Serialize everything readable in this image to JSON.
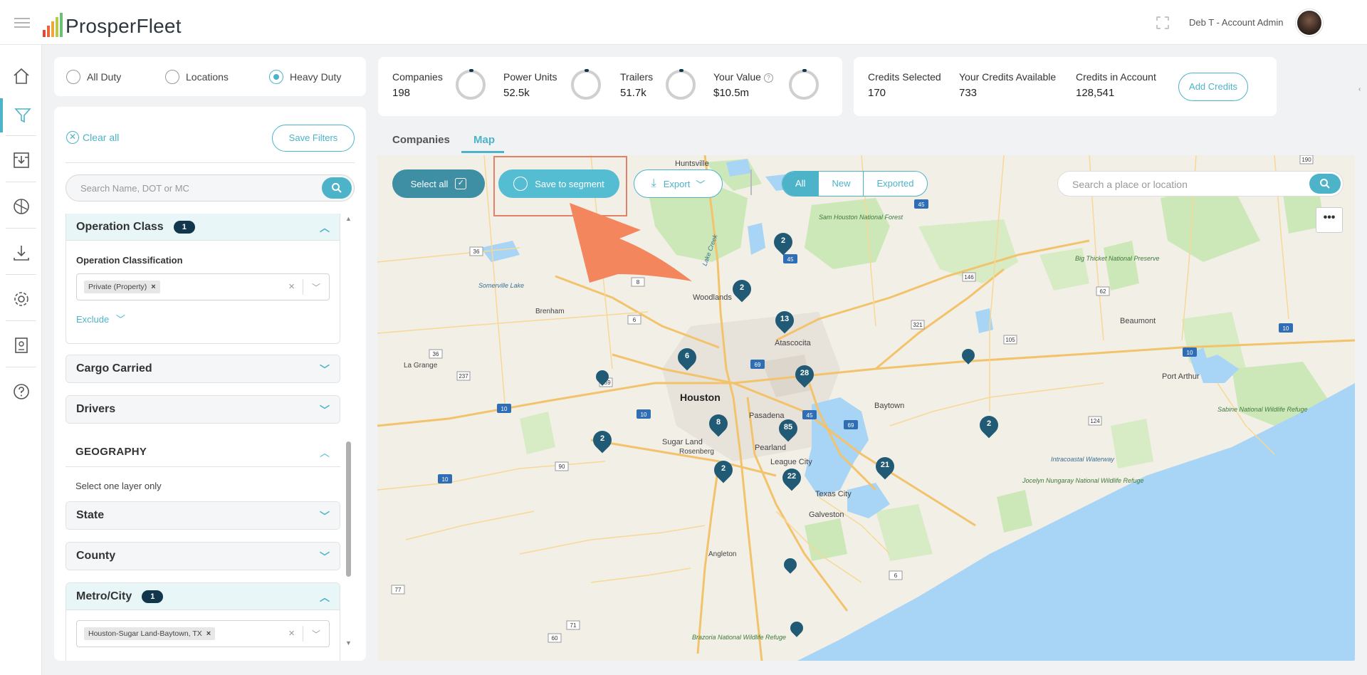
{
  "app": {
    "name": "ProsperFleet",
    "user": "Deb T - Account Admin"
  },
  "duty": {
    "options": [
      "All Duty",
      "Locations",
      "Heavy Duty"
    ],
    "selected": "Heavy Duty"
  },
  "filters": {
    "clear_all": "Clear all",
    "save_filters": "Save Filters",
    "search_placeholder": "Search Name, DOT or MC",
    "operation_class": {
      "title": "Operation Class",
      "count": "1",
      "sub_label": "Operation Classification",
      "chip": "Private (Property)",
      "exclude": "Exclude"
    },
    "cargo_carried": "Cargo Carried",
    "drivers": "Drivers",
    "geography": {
      "title": "GEOGRAPHY",
      "note": "Select one layer only",
      "state": "State",
      "county": "County",
      "metro": {
        "title": "Metro/City",
        "count": "1",
        "chip": "Houston-Sugar Land-Baytown, TX"
      }
    }
  },
  "stats": {
    "companies": {
      "label": "Companies",
      "value": "198"
    },
    "power_units": {
      "label": "Power Units",
      "value": "52.5k"
    },
    "trailers": {
      "label": "Trailers",
      "value": "51.7k"
    },
    "your_value": {
      "label": "Your Value",
      "value": "$10.5m"
    }
  },
  "credits": {
    "selected": {
      "label": "Credits Selected",
      "value": "170"
    },
    "available": {
      "label": "Your Credits Available",
      "value": "733"
    },
    "account": {
      "label": "Credits in Account",
      "value": "128,541"
    },
    "add_button": "Add Credits"
  },
  "tabs": [
    "Companies",
    "Map"
  ],
  "active_tab": "Map",
  "map": {
    "select_all": "Select all",
    "save_to_segment": "Save to segment",
    "export": "Export",
    "segments": [
      "All",
      "New",
      "Exported"
    ],
    "active_segment": "All",
    "search_placeholder": "Search a place or location",
    "more": "•••",
    "markers": [
      "2",
      "2",
      "13",
      "6",
      "28",
      "8",
      "85",
      "2",
      "2",
      "22",
      "21",
      "2"
    ],
    "places": {
      "houston": "Houston",
      "huntsville": "Huntsville",
      "woodlands": "Woodlands",
      "atascocita": "Atascocita",
      "baytown": "Baytown",
      "pasadena": "Pasadena",
      "sugar_land": "Sugar Land",
      "rosenberg": "Rosenberg",
      "pearland": "Pearland",
      "league_city": "League City",
      "texas_city": "Texas City",
      "galveston": "Galveston",
      "beaumont": "Beaumont",
      "port_arthur": "Port Arthur",
      "brenham": "Brenham",
      "la_grange": "La Grange",
      "angleton": "Angleton",
      "sam_houston_forest": "Sam Houston National Forest",
      "big_thicket": "Big Thicket National Preserve",
      "sabine": "Sabine National Wildlife Refuge",
      "jocelyn": "Jocelyn Nungaray National Wildlife Refuge",
      "brazoria": "Brazoria National Wildlife Refuge",
      "intracoastal": "Intracoastal Waterway",
      "somerville": "Somerville Lake",
      "lake_creek": "Lake Creek"
    },
    "highways": [
      "45",
      "45",
      "45",
      "10",
      "10",
      "10",
      "10",
      "10",
      "69",
      "69",
      "36",
      "36",
      "6",
      "6",
      "8",
      "159",
      "237",
      "71",
      "60",
      "77",
      "90",
      "105",
      "146",
      "62",
      "321",
      "124",
      "190"
    ]
  },
  "colors": {
    "accent": "#4cb3c9",
    "dark": "#12374d",
    "marker": "#215a74",
    "highlight": "#e2806a",
    "arrow": "#f4865e"
  }
}
